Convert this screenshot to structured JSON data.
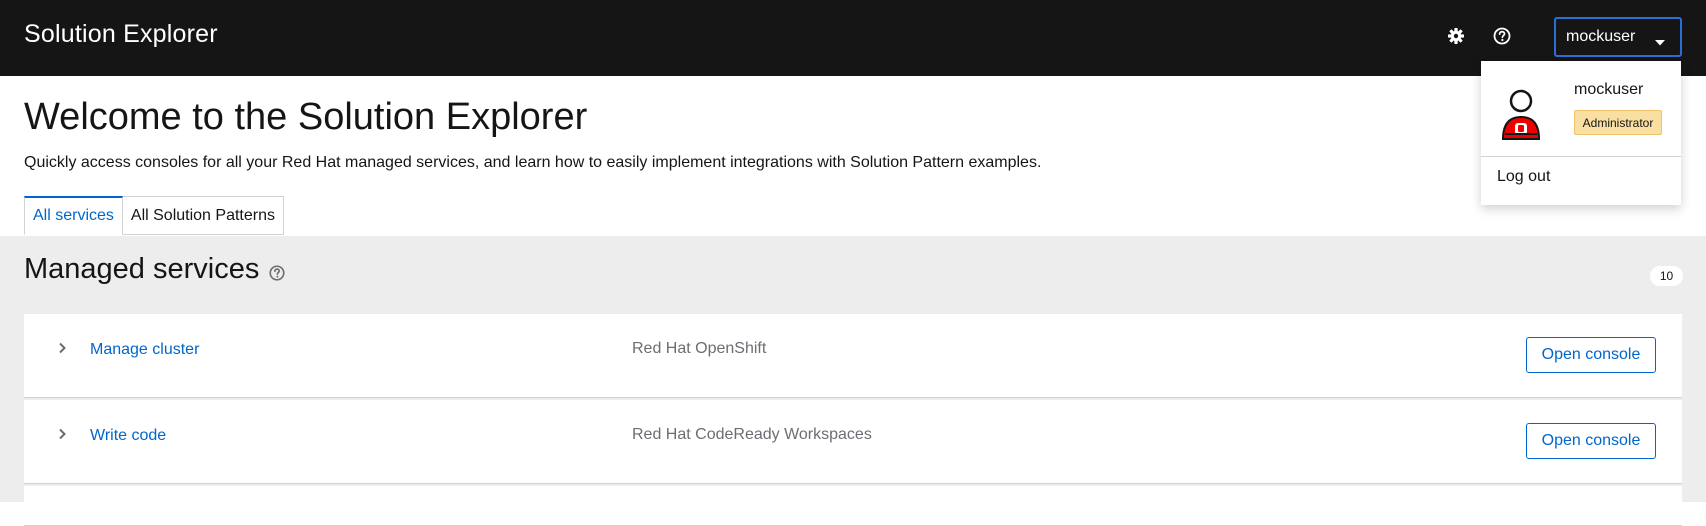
{
  "masthead": {
    "brand": "Solution Explorer",
    "settings_icon": "gear-icon",
    "help_icon": "question-circle-icon",
    "user_toggle_label": "mockuser",
    "caret_icon": "caret-down-icon"
  },
  "page": {
    "title": "Welcome to the Solution Explorer",
    "description": "Quickly access consoles for all your Red Hat managed services, and learn how to easily implement integrations with Solution Pattern examples."
  },
  "tabs": [
    {
      "label": "All services",
      "active": true
    },
    {
      "label": "All Solution Patterns",
      "active": false
    }
  ],
  "managed_services": {
    "title": "Managed services",
    "help_icon": "question-circle-icon",
    "count": "10",
    "rows": [
      {
        "name": "Manage cluster",
        "product": "Red Hat OpenShift",
        "action": "Open console"
      },
      {
        "name": "Write code",
        "product": "Red Hat CodeReady Workspaces",
        "action": "Open console"
      }
    ]
  },
  "user_menu": {
    "avatar_icon": "user-avatar-icon",
    "username": "mockuser",
    "role": "Administrator",
    "logout_label": "Log out"
  },
  "colors": {
    "masthead_bg": "#151515",
    "link": "#0066cc",
    "section_bg": "#ededed",
    "focus_border": "#2b6fd6",
    "role_badge_bg": "#f9e0a2",
    "avatar_red": "#ee0000"
  }
}
